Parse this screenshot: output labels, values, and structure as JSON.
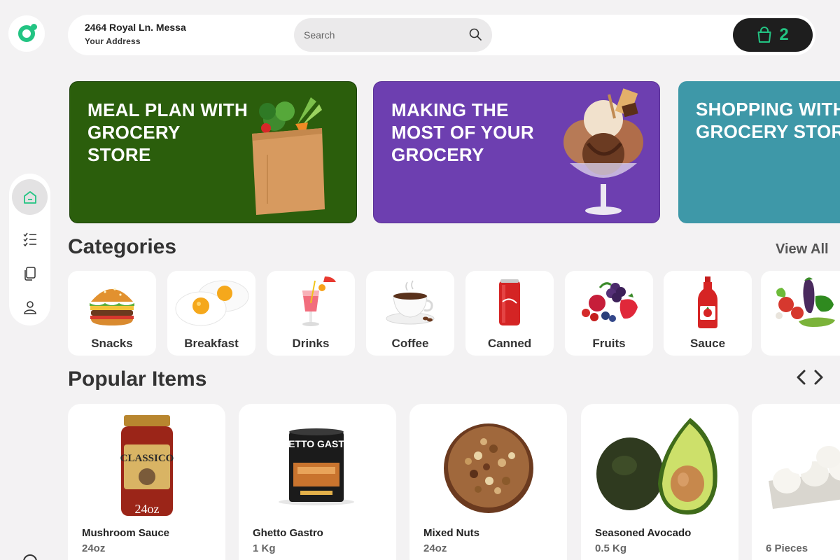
{
  "header": {
    "address_line1": "2464 Royal Ln. Messa",
    "address_line2": "Your Address",
    "search_placeholder": "Search",
    "cart_count": "2"
  },
  "colors": {
    "accent": "#23c483",
    "banner_green": "#2b5e0c",
    "banner_purple": "#6d3fb0",
    "banner_teal": "#3e98a8"
  },
  "sidebar": {
    "items": [
      {
        "icon": "home-icon",
        "active": true
      },
      {
        "icon": "list-icon",
        "active": false
      },
      {
        "icon": "documents-icon",
        "active": false
      },
      {
        "icon": "user-icon",
        "active": false
      }
    ]
  },
  "banners": [
    {
      "title": "MEAL PLAN WITH GROCERY STORE",
      "image": "grocery-bag-image"
    },
    {
      "title": "MAKING THE MOST OF YOUR GROCERY",
      "image": "ice-cream-sundae-image"
    },
    {
      "title": "SHOPPING WITH GROCERY STORE",
      "image": ""
    }
  ],
  "categories": {
    "title": "Categories",
    "view_all": "View All",
    "items": [
      {
        "label": "Snacks",
        "image": "burger-image"
      },
      {
        "label": "Breakfast",
        "image": "fried-eggs-image"
      },
      {
        "label": "Drinks",
        "image": "cocktail-image"
      },
      {
        "label": "Coffee",
        "image": "coffee-cup-image"
      },
      {
        "label": "Canned",
        "image": "cola-can-image"
      },
      {
        "label": "Fruits",
        "image": "berries-image"
      },
      {
        "label": "Sauce",
        "image": "ketchup-bottle-image"
      },
      {
        "label": "",
        "image": "vegetables-image"
      }
    ]
  },
  "popular": {
    "title": "Popular Items",
    "items": [
      {
        "name": "Mushroom Sauce",
        "qty": "24oz",
        "image": "pasta-sauce-jar-image",
        "jar_brand": "CLASSICO",
        "jar_size": "24oz"
      },
      {
        "name": "Ghetto Gastro",
        "qty": "1 Kg",
        "image": "pancake-mix-can-image",
        "can_brand": "GHETTO GASTRO"
      },
      {
        "name": "Mixed Nuts",
        "qty": "24oz",
        "image": "mixed-nuts-bowl-image"
      },
      {
        "name": "Seasoned Avocado",
        "qty": "0.5 Kg",
        "image": "avocado-image"
      },
      {
        "name": "",
        "qty": "6 Pieces",
        "image": "eggs-carton-image"
      }
    ]
  }
}
